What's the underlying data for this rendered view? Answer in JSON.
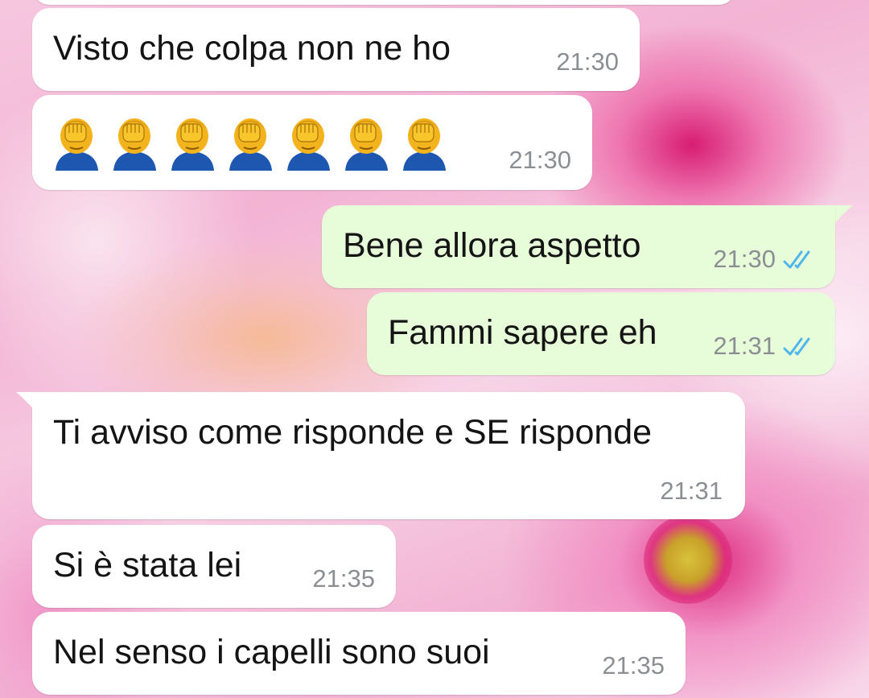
{
  "conversation": {
    "messages": [
      {
        "direction": "in",
        "text": "Visto che colpa non ne ho",
        "time": "21:30"
      },
      {
        "direction": "in",
        "emoji": "facepalm",
        "count": 7,
        "time": "21:30"
      },
      {
        "direction": "out",
        "text": "Bene allora aspetto",
        "time": "21:30",
        "status": "read"
      },
      {
        "direction": "out",
        "text": "Fammi sapere eh",
        "time": "21:31",
        "status": "read"
      },
      {
        "direction": "in",
        "text": "Ti avviso come risponde e SE risponde",
        "time": "21:31"
      },
      {
        "direction": "in",
        "text": "Si è stata lei",
        "time": "21:35"
      },
      {
        "direction": "in",
        "text": "Nel senso i capelli sono suoi",
        "time": "21:35"
      }
    ]
  },
  "icons": {
    "read_receipt": "double-check-icon",
    "emoji": "person-facepalming-emoji"
  },
  "colors": {
    "incoming_bubble": "#ffffff",
    "outgoing_bubble": "#e7fcd8",
    "read_check": "#4fb6ec",
    "timestamp": "#8b8f93"
  }
}
